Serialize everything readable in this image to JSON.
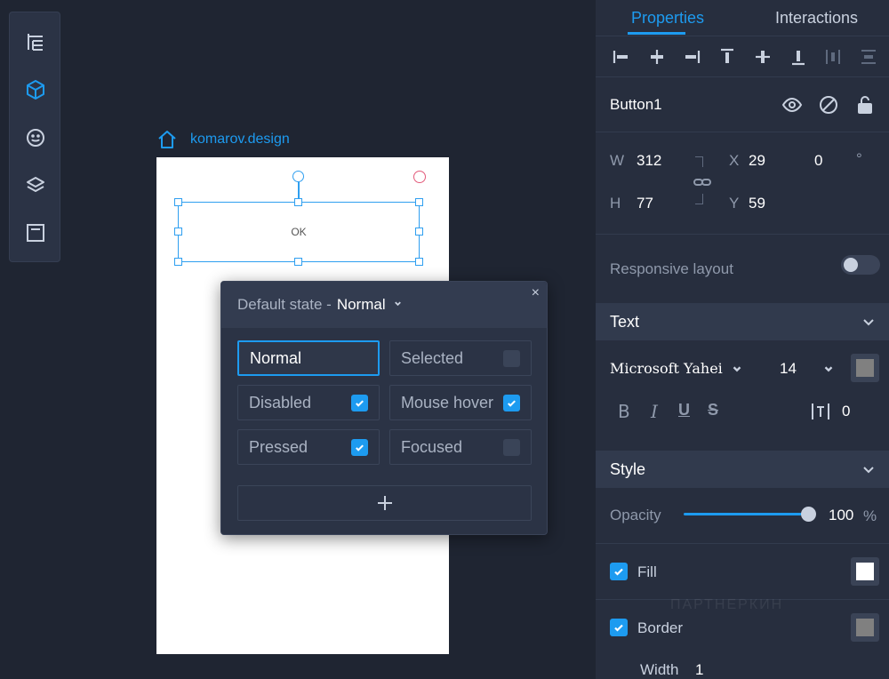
{
  "toolbar": {
    "items": [
      {
        "icon": "outline-tree-icon",
        "active": false
      },
      {
        "icon": "cube-icon",
        "active": true
      },
      {
        "icon": "smiley-icon",
        "active": false
      },
      {
        "icon": "layers-icon",
        "active": false
      },
      {
        "icon": "panel-icon",
        "active": false
      }
    ]
  },
  "canvas": {
    "artboard_title": "komarov.design",
    "button_text": "OK"
  },
  "state_popup": {
    "label": "Default state -",
    "current": "Normal",
    "close": "×",
    "states": [
      {
        "label": "Normal",
        "checked": null
      },
      {
        "label": "Selected",
        "checked": false
      },
      {
        "label": "Disabled",
        "checked": true
      },
      {
        "label": "Mouse hover",
        "checked": true
      },
      {
        "label": "Pressed",
        "checked": true
      },
      {
        "label": "Focused",
        "checked": false
      }
    ],
    "add_icon": "plus-icon"
  },
  "panel": {
    "tabs": {
      "properties": "Properties",
      "interactions": "Interactions"
    },
    "element_name": "Button1",
    "geometry": {
      "w_label": "W",
      "w": "312",
      "h_label": "H",
      "h": "77",
      "x_label": "X",
      "x": "29",
      "y_label": "Y",
      "y": "59",
      "rotation": "0",
      "degree": "°"
    },
    "responsive_layout": "Responsive layout",
    "text_section": {
      "title": "Text",
      "font": "Microsoft Yahei",
      "size": "14",
      "bold": "B",
      "italic": "I",
      "underline": "U",
      "strike": "S",
      "spacing": "0"
    },
    "style_section": {
      "title": "Style",
      "opacity_label": "Opacity",
      "opacity": "100",
      "opacity_unit": "%",
      "opacity_fraction": 1.0,
      "fill_label": "Fill",
      "border_label": "Border",
      "width_label": "Width",
      "width_value": "1"
    },
    "watermark": "ПАРТНЕРКИН"
  },
  "colors": {
    "accent": "#1d9bf0",
    "background": "#1f2532",
    "panel": "#272e3e",
    "fill_swatch": "#ffffff",
    "text_swatch": "#808080",
    "border_swatch": "#808080"
  }
}
